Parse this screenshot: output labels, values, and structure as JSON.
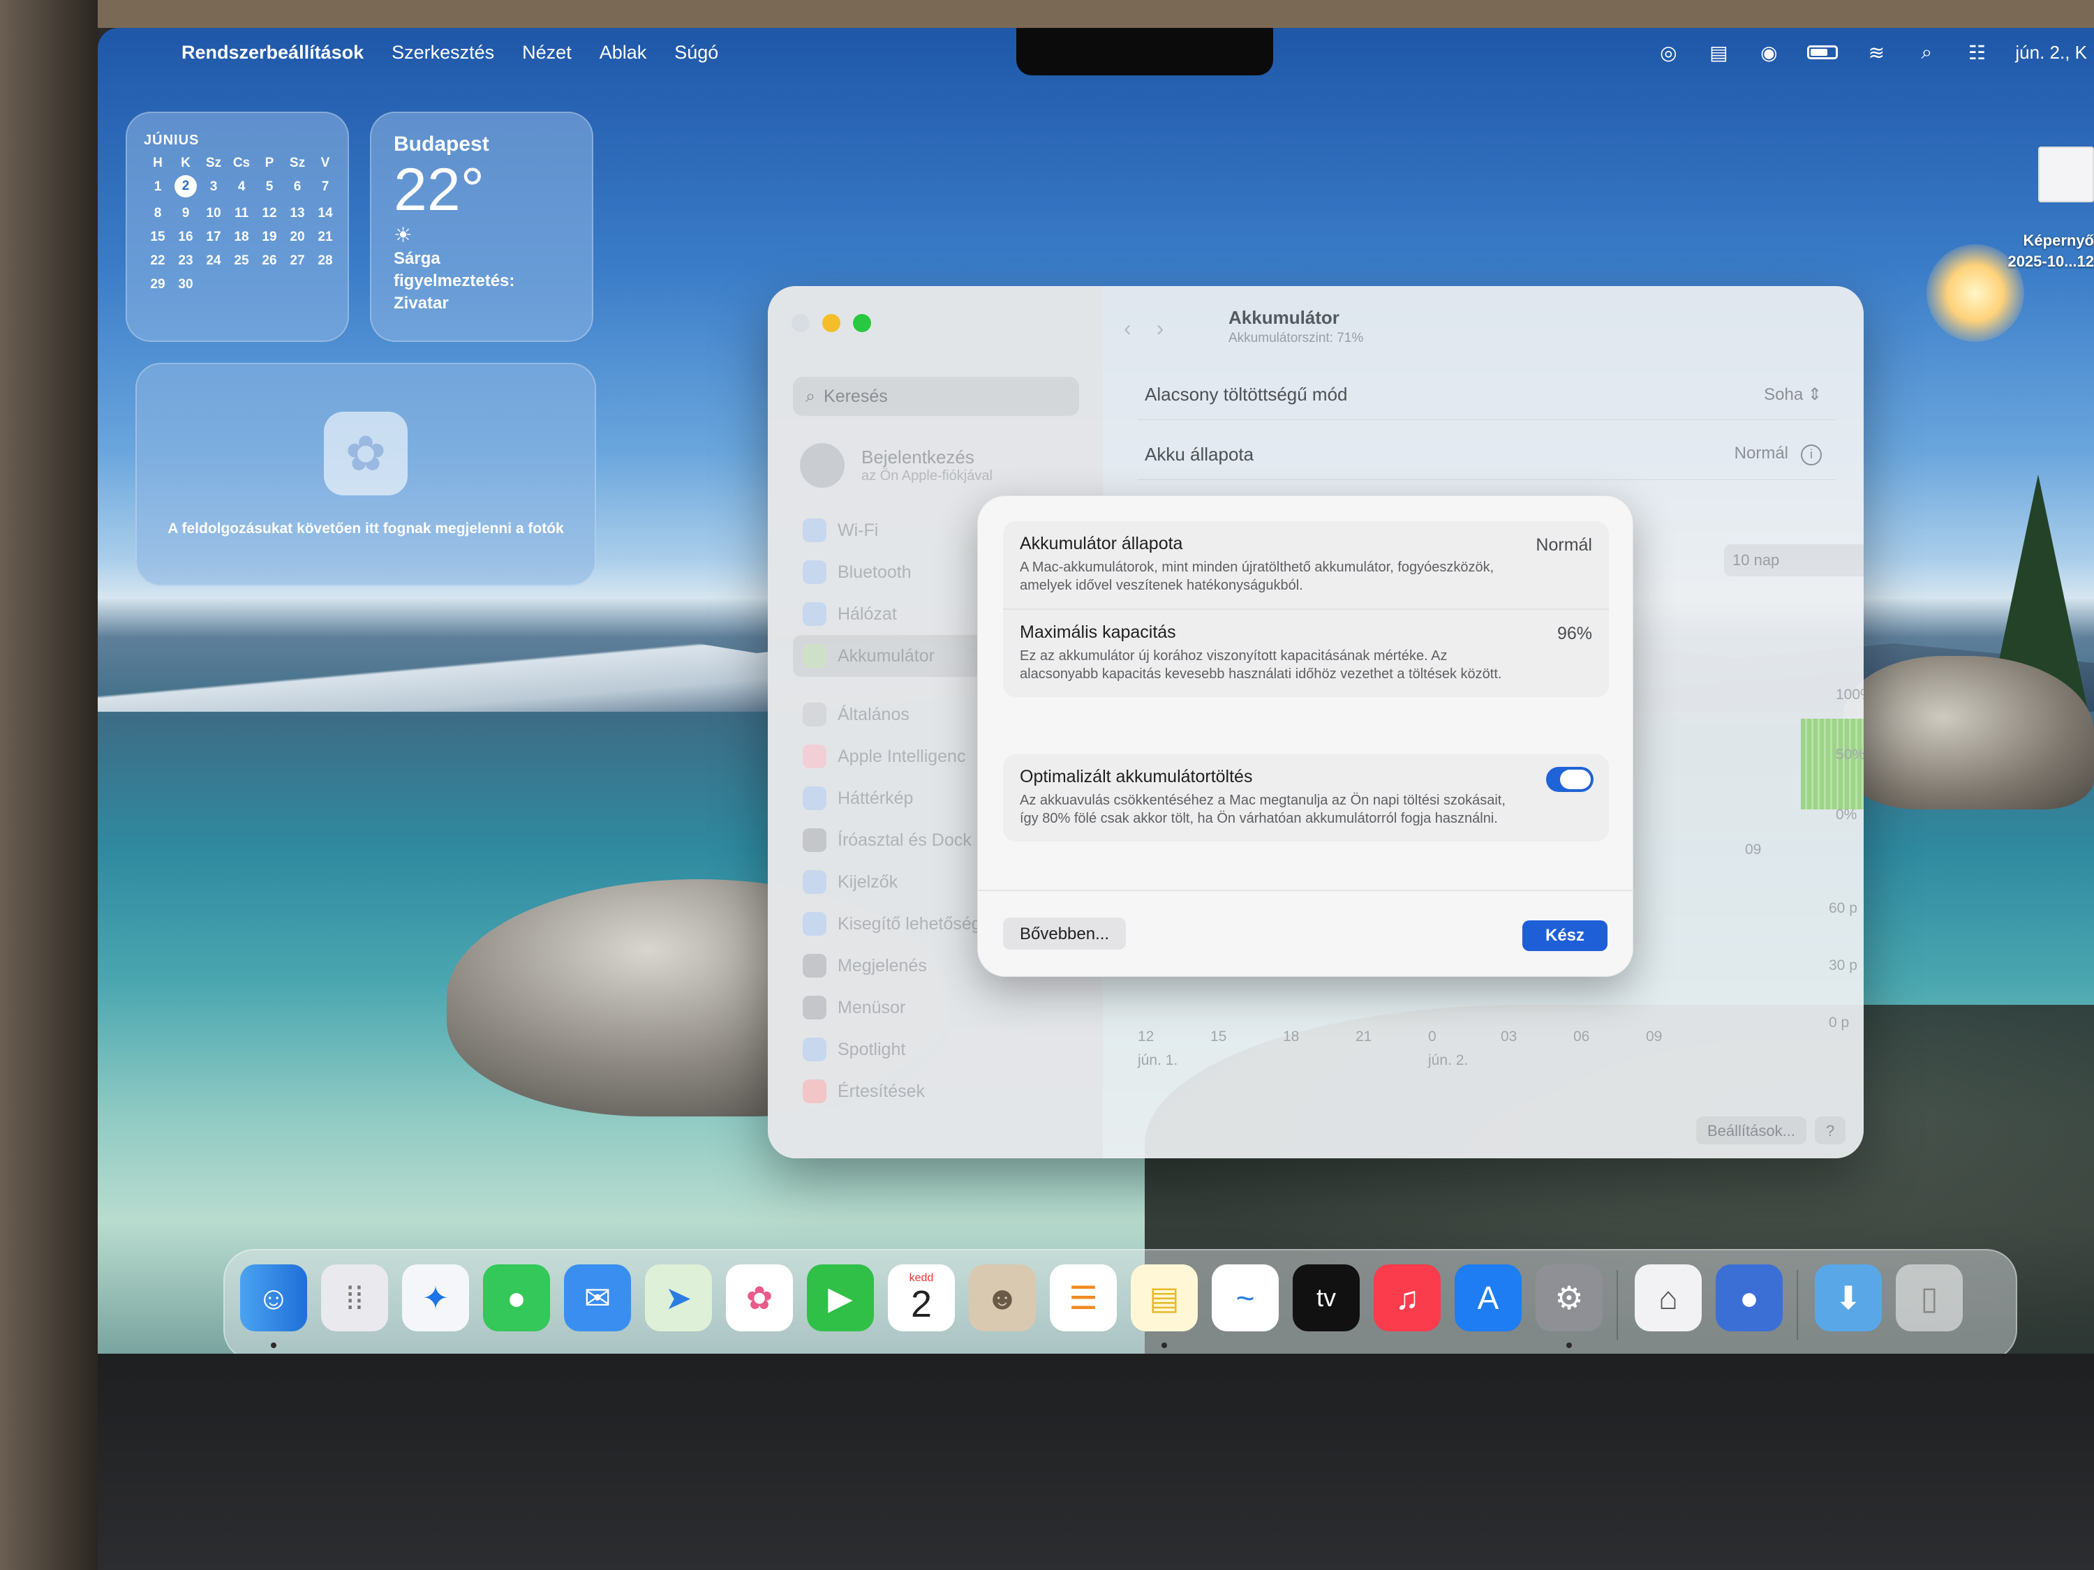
{
  "menubar": {
    "app_name": "Rendszerbeállítások",
    "items": [
      "Szerkesztés",
      "Nézet",
      "Ablak",
      "Súgó"
    ],
    "clock": "jún. 2., K"
  },
  "desktop_item": {
    "label_1": "Képernyő",
    "label_2": "2025-10...12"
  },
  "calendar_widget": {
    "month": "JÚNIUS",
    "weekdays": [
      "H",
      "K",
      "Sz",
      "Cs",
      "P",
      "Sz",
      "V"
    ],
    "weeks": [
      [
        "1",
        "2",
        "3",
        "4",
        "5",
        "6",
        "7"
      ],
      [
        "8",
        "9",
        "10",
        "11",
        "12",
        "13",
        "14"
      ],
      [
        "15",
        "16",
        "17",
        "18",
        "19",
        "20",
        "21"
      ],
      [
        "22",
        "23",
        "24",
        "25",
        "26",
        "27",
        "28"
      ],
      [
        "29",
        "30",
        "",
        "",
        "",
        "",
        ""
      ]
    ],
    "today": "2"
  },
  "weather_widget": {
    "city": "Budapest",
    "temp": "22°",
    "alert_line_1": "Sárga",
    "alert_line_2": "figyelmeztetés:",
    "alert_line_3": "Zivatar"
  },
  "photos_widget": {
    "text": "A feldolgozásukat követően itt fognak megjelenni a fotók"
  },
  "settings": {
    "search_placeholder": "Keresés",
    "signin_title": "Bejelentkezés",
    "signin_sub": "az Ön Apple-fiókjával",
    "sidebar": [
      "Wi-Fi",
      "Bluetooth",
      "Hálózat",
      "Akkumulátor",
      "Általános",
      "Apple Intelligenc",
      "Háttérkép",
      "Íróasztal és Dock",
      "Kijelzők",
      "Kisegítő lehetőség",
      "Megjelenés",
      "Menüsor",
      "Spotlight",
      "Értesítések"
    ],
    "pane_title": "Akkumulátor",
    "pane_subtitle": "Akkumulátorszint: 71%",
    "rows": {
      "low_power_label": "Alacsony töltöttségű mód",
      "low_power_value": "Soha",
      "health_label": "Akku állapota",
      "health_value": "Normál"
    },
    "tenday_label": "10 nap",
    "chart_y_percent": [
      "100%",
      "50%",
      "0%"
    ],
    "chart_y_minutes": [
      "60 p",
      "30 p",
      "0 p"
    ],
    "chart_x": [
      "12",
      "15",
      "18",
      "21",
      "0",
      "03",
      "06",
      "09"
    ],
    "chart_x_upper": "09",
    "chart_day_1": "jún. 1.",
    "chart_day_2": "jún. 2.",
    "options_button": "Beállítások...",
    "help_button": "?"
  },
  "dialog": {
    "items": [
      {
        "title": "Akkumulátor állapota",
        "value": "Normál",
        "desc": "A Mac-akkumulátorok, mint minden újratölthető akkumulátor, fogyóeszközök, amelyek idővel veszítenek hatékonyságukból."
      },
      {
        "title": "Maximális kapacitás",
        "value": "96%",
        "desc": "Ez az akkumulátor új korához viszonyított kapacitásának mértéke. Az alacsonyabb kapacitás kevesebb használati időhöz vezethet a töltések között."
      },
      {
        "title": "Optimalizált akkumulátortöltés",
        "desc": "Az akkuavulás csökkentéséhez a Mac megtanulja az Ön napi töltési szokásait, így 80% fölé csak akkor tölt, ha Ön várhatóan akkumulátorról fogja használni.",
        "toggle_on": true
      }
    ],
    "more_button": "Bővebben...",
    "done_button": "Kész"
  },
  "dock": {
    "calendar_day": "kedd",
    "calendar_date": "2",
    "tv_label": "tv"
  }
}
